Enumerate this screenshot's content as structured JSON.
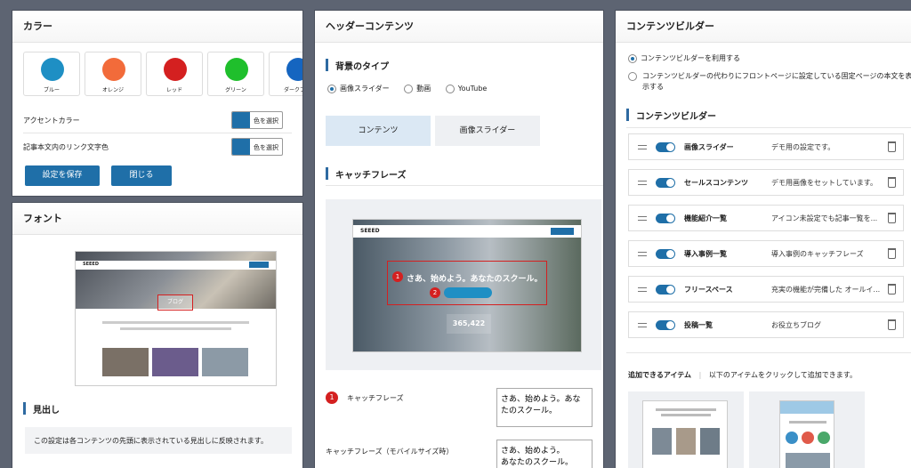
{
  "color_panel": {
    "title": "カラー",
    "swatches": [
      {
        "label": "ブルー",
        "color": "#1e8fc4"
      },
      {
        "label": "オレンジ",
        "color": "#f26b3a"
      },
      {
        "label": "レッド",
        "color": "#d42020"
      },
      {
        "label": "グリーン",
        "color": "#1fbf2c"
      },
      {
        "label": "ダークブル",
        "color": "#1565c0"
      }
    ],
    "rows": [
      {
        "label": "アクセントカラー",
        "button": "色を選択"
      },
      {
        "label": "記事本文内のリンク文字色",
        "button": "色を選択"
      }
    ],
    "save": "設定を保存",
    "close": "閉じる"
  },
  "font_panel": {
    "title": "フォント",
    "preview": {
      "logo": "SEEED",
      "label": "ブログ"
    },
    "heading": "見出し",
    "note": "この設定は各コンテンツの先頭に表示されている見出しに反映されます。"
  },
  "header_panel": {
    "title": "ヘッダーコンテンツ",
    "bg_section": "背景のタイプ",
    "bg_options": [
      "画像スライダー",
      "動画",
      "YouTube"
    ],
    "tabs": [
      "コンテンツ",
      "画像スライダー"
    ],
    "catch_section": "キャッチフレーズ",
    "preview": {
      "logo": "SEEED",
      "headline": "さあ、始めよう。あなたのスクール。",
      "count": "365,422"
    },
    "field1": {
      "num": "1",
      "label": "キャッチフレーズ",
      "value": "さあ、始めよう。あな\nたのスクール。"
    },
    "field2": {
      "label": "キャッチフレーズ（モバイルサイズ時）",
      "value": "さあ、始めよう。\nあなたのスクール。"
    }
  },
  "builder_panel": {
    "title": "コンテンツビルダー",
    "radio1": "コンテンツビルダーを利用する",
    "radio2": "コンテンツビルダーの代わりにフロントページに設定している固定ページの本文を表示する",
    "section": "コンテンツビルダー",
    "rows": [
      {
        "name": "画像スライダー",
        "desc": "デモ用の設定です。"
      },
      {
        "name": "セールスコンテンツ",
        "desc": "デモ用画像をセットしています。"
      },
      {
        "name": "機能紹介一覧",
        "desc": "アイコン未設定でも記事一覧を..."
      },
      {
        "name": "導入事例一覧",
        "desc": "導入事例のキャッチフレーズ"
      },
      {
        "name": "フリースペース",
        "desc": "充実の機能が完備した オールイ..."
      },
      {
        "name": "投稿一覧",
        "desc": "お役立ちブログ"
      }
    ],
    "add_label": "追加できるアイテム",
    "add_hint": "以下のアイテムをクリックして追加できます。"
  }
}
